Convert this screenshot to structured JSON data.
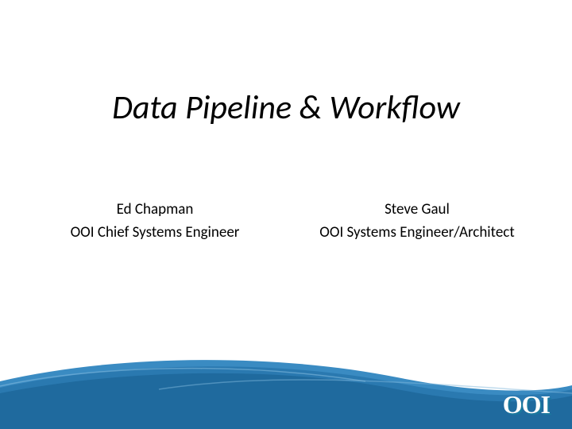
{
  "title": "Data Pipeline & Workflow",
  "authors": [
    {
      "name": "Ed Chapman",
      "role": "OOI Chief Systems Engineer"
    },
    {
      "name": "Steve Gaul",
      "role": "OOI Systems Engineer/Architect"
    }
  ],
  "logo": "OOI",
  "colors": {
    "wave_dark": "#1f6a9e",
    "wave_mid": "#3a8bc2",
    "wave_light": "#7fb8dc"
  }
}
